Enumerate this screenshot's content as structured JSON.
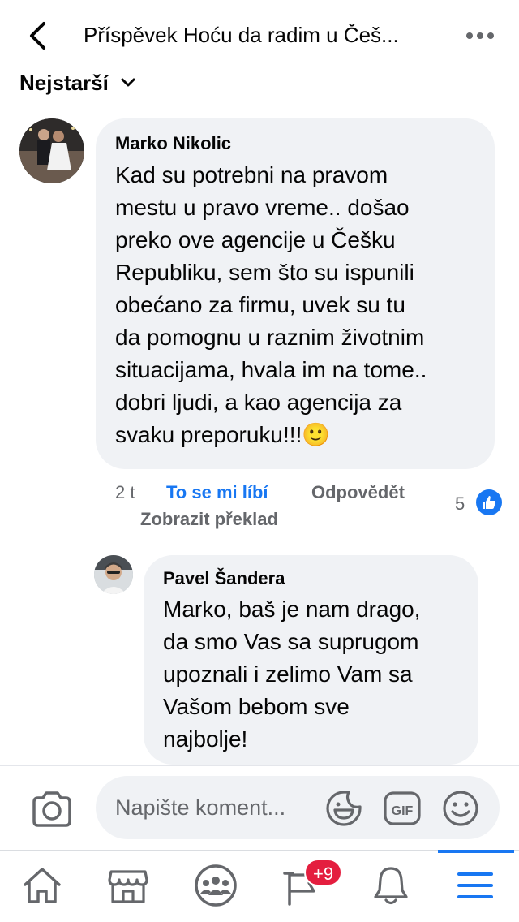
{
  "header": {
    "title": "Příspěvek Hoću da radim u Češ..."
  },
  "sort": {
    "label": "Nejstarší"
  },
  "comment1": {
    "author": "Marko Nikolic",
    "text": "Kad su potrebni na pravom\nmestu u pravo vreme.. došao\npreko ove agencije u Češku\nRepubliku, sem što su ispunili\nobećano za firmu, uvek su tu\nda pomognu u raznim životnim\nsituacijama, hvala im na tome..\ndobri ljudi, a kao agencija za\nsvaku preporuku!!!🙂",
    "time": "2 t",
    "like_label": "To se mi líbí",
    "reply_label": "Odpovědět",
    "translate_label": "Zobrazit překlad",
    "reaction_count": "5"
  },
  "reply1": {
    "author": "Pavel Šandera",
    "text": "Marko, baš je nam drago,\nda smo Vas sa suprugom\nupoznali i zelimo Vam sa\nVašom bebom sve\nnajbolje!"
  },
  "composer": {
    "placeholder": "Napište koment..."
  },
  "tabbar": {
    "notification_badge": "+9"
  },
  "icons": {
    "back": "chevron-left-icon",
    "more": "more-horizontal-icon",
    "sort": "chevron-down-icon",
    "like_reaction": "thumbs-up-icon",
    "camera": "camera-icon",
    "sticker": "sticker-icon",
    "gif": "gif-icon",
    "emoji": "emoji-icon",
    "home": "home-icon",
    "marketplace": "marketplace-icon",
    "groups": "groups-icon",
    "pages": "flag-icon",
    "notifications": "bell-icon",
    "menu": "menu-icon"
  },
  "colors": {
    "accent": "#1877f2",
    "bubble": "#f0f2f5",
    "secondary_text": "#65676b",
    "badge": "#e41e3f"
  }
}
